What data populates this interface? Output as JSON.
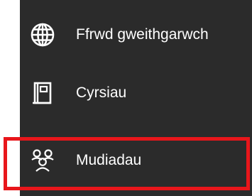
{
  "sidebar": {
    "items": [
      {
        "label": "Ffrwd gweithgarwch",
        "icon": "globe-icon"
      },
      {
        "label": "Cyrsiau",
        "icon": "book-icon"
      },
      {
        "label": "Mudiadau",
        "icon": "people-group-icon",
        "highlighted": true
      }
    ]
  },
  "colors": {
    "panel_background": "#2b2b2b",
    "text": "#ffffff",
    "highlight": "#e8161b"
  }
}
